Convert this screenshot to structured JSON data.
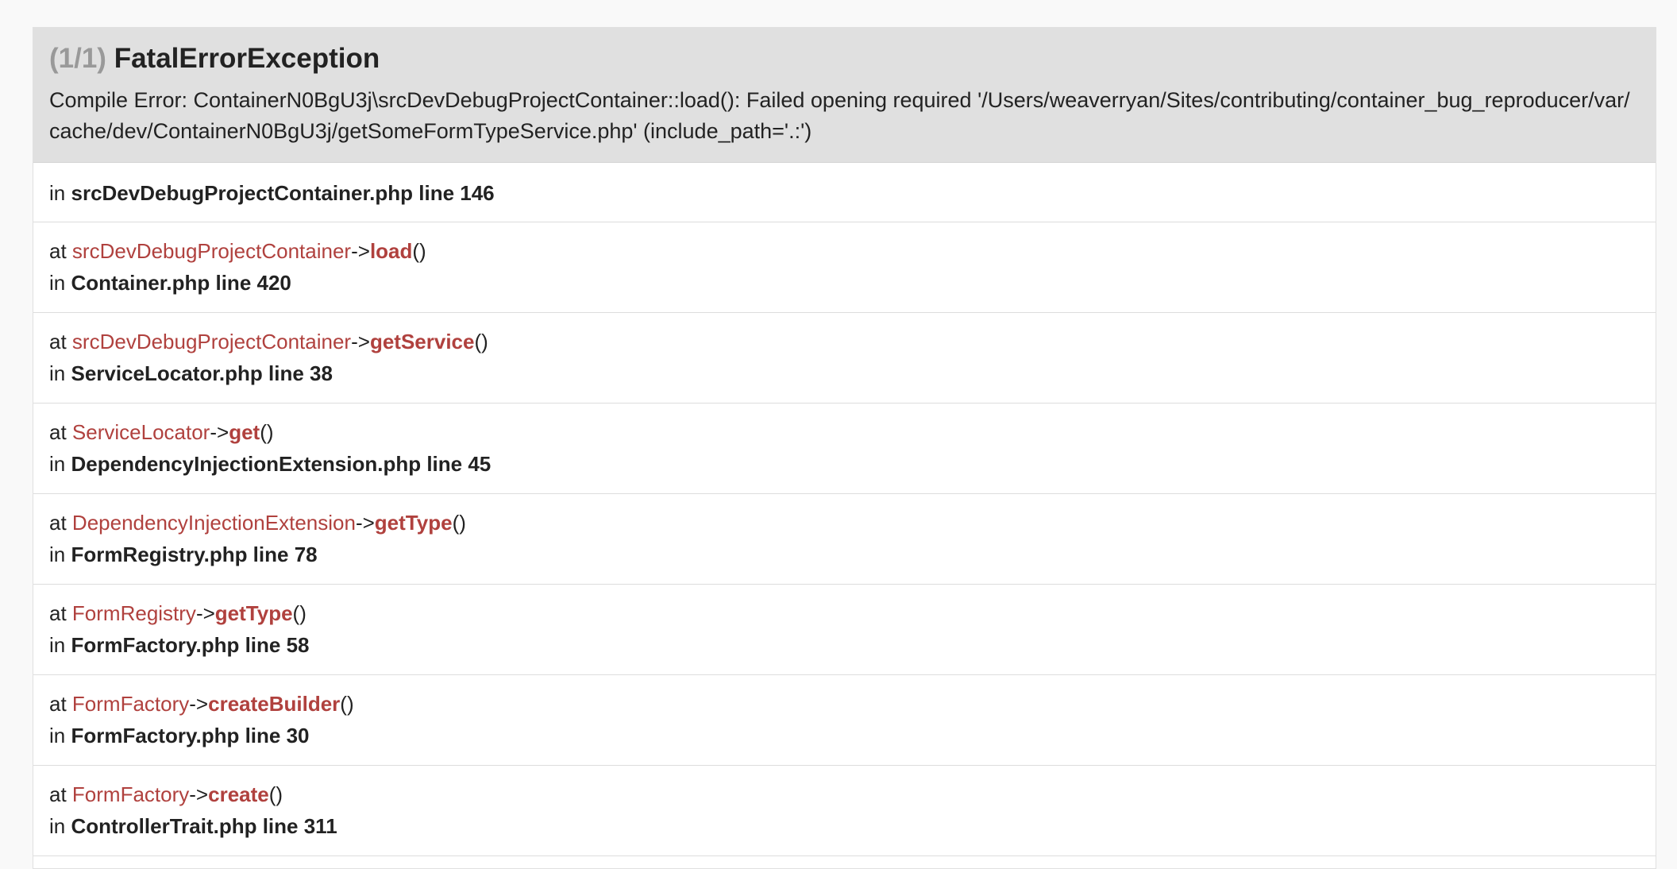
{
  "exception": {
    "counter": "(1/1)",
    "class": "FatalErrorException",
    "message": "Compile Error: ContainerN0BgU3j\\srcDevDebugProjectContainer::load(): Failed opening required '/Users/weaverryan/Sites/contributing/container_bug_reproducer/var/cache/dev/ContainerN0BgU3j/getSomeFormTypeService.php' (include_path='.:')"
  },
  "location": {
    "prefix": "in",
    "file": "srcDevDebugProjectContainer.php line 146"
  },
  "labels": {
    "at": "at",
    "in": "in",
    "arrow": "->",
    "parens": "()"
  },
  "frames": [
    {
      "class": "srcDevDebugProjectContainer",
      "method": "load",
      "file": "Container.php line 420"
    },
    {
      "class": "srcDevDebugProjectContainer",
      "method": "getService",
      "file": "ServiceLocator.php line 38"
    },
    {
      "class": "ServiceLocator",
      "method": "get",
      "file": "DependencyInjectionExtension.php line 45"
    },
    {
      "class": "DependencyInjectionExtension",
      "method": "getType",
      "file": "FormRegistry.php line 78"
    },
    {
      "class": "FormRegistry",
      "method": "getType",
      "file": "FormFactory.php line 58"
    },
    {
      "class": "FormFactory",
      "method": "createBuilder",
      "file": "FormFactory.php line 30"
    },
    {
      "class": "FormFactory",
      "method": "create",
      "file": "ControllerTrait.php line 311"
    }
  ],
  "colors": {
    "accent": "#b0413e",
    "header_bg": "#e0e0e0",
    "counter": "#999999"
  }
}
